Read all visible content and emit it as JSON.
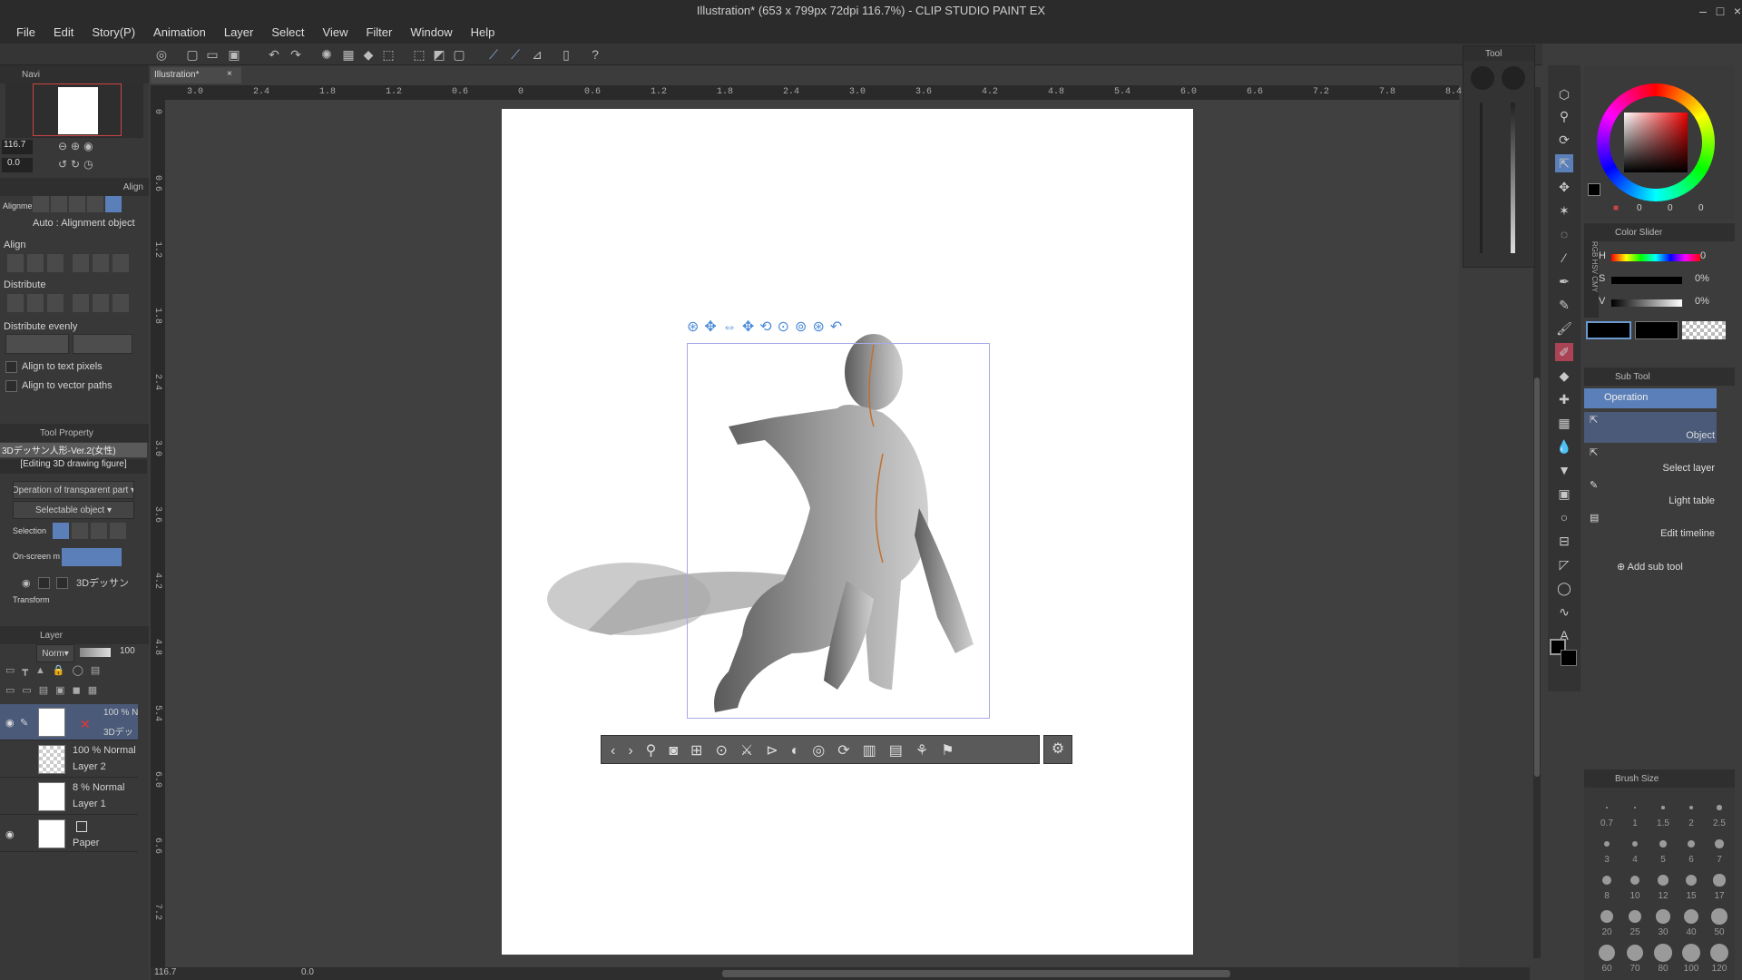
{
  "window": {
    "title": "Illustration* (653 x 799px 72dpi 116.7%)  - CLIP STUDIO PAINT EX"
  },
  "menu": [
    "File",
    "Edit",
    "Story(P)",
    "Animation",
    "Layer",
    "Select",
    "View",
    "Filter",
    "Window",
    "Help"
  ],
  "canvas_tab": {
    "label": "Illustration*",
    "close": "×"
  },
  "ruler_h_labels": [
    "3.0",
    "2.4",
    "1.8",
    "1.2",
    "0.6",
    "0",
    "0.6",
    "1.2",
    "1.8",
    "2.4",
    "3.0",
    "3.6",
    "4.2",
    "4.8",
    "5.4",
    "6.0",
    "6.6",
    "7.2",
    "7.8",
    "8.4"
  ],
  "ruler_v_labels": [
    "0",
    "0.6",
    "1.2",
    "1.8",
    "2.4",
    "3.0",
    "3.6",
    "4.2",
    "4.8",
    "5.4",
    "6.0",
    "6.6",
    "7.2"
  ],
  "navigator": {
    "title": "Navi",
    "zoom": "116.7",
    "angle": "0.0"
  },
  "align_panel": {
    "tab": "Align",
    "alignment_label": "Alignme",
    "auto_text": "Auto : Alignment object",
    "align_heading": "Align",
    "distribute_heading": "Distribute",
    "distribute_evenly_heading": "Distribute evenly",
    "align_text_pixels": "Align to text pixels",
    "align_vector_paths": "Align to vector paths"
  },
  "tool_property": {
    "title": "Tool Property",
    "name": "3Dデッサン人形-Ver.2(女性)",
    "editing": "[Editing 3D drawing figure]",
    "operation_transparent": "Operation of transparent part",
    "selectable_object": "Selectable object",
    "selection_label": "Selection",
    "onscreen_label": "On-screen m",
    "object_name": "3Dデッサン",
    "transform_label": "Transform"
  },
  "layer_panel": {
    "title": "Layer",
    "blend": "Norm",
    "opacity": "100",
    "layers": [
      {
        "line1": "100 % N",
        "line2": "3Dデッ",
        "selected": true
      },
      {
        "line1": "100 % Normal",
        "line2": "Layer 2",
        "selected": false
      },
      {
        "line1": "8 % Normal",
        "line2": "Layer 1",
        "selected": false
      },
      {
        "line1": "",
        "line2": "Paper",
        "selected": false
      }
    ]
  },
  "status_bar": {
    "zoom": "116.7",
    "angle": "0.0"
  },
  "color_wheel": {
    "values": [
      "0",
      "0",
      "0"
    ]
  },
  "color_slider": {
    "title": "Color Slider",
    "rows": [
      {
        "label": "H",
        "value": "0"
      },
      {
        "label": "S",
        "value": "0%"
      },
      {
        "label": "V",
        "value": "0%"
      }
    ],
    "hsv_tab": "HSV",
    "rgb_tab": "RGB",
    "cmy_tab": "CMY"
  },
  "tool_panel": {
    "title": "Tool"
  },
  "sub_tool": {
    "title": "Sub Tool",
    "group": "Operation",
    "items": [
      "Object",
      "Select layer",
      "Light table",
      "Edit timeline"
    ],
    "add": "Add sub tool"
  },
  "brush_size": {
    "title": "Brush Size",
    "sizes": [
      "0.7",
      "1",
      "1.5",
      "2",
      "2.5",
      "3",
      "4",
      "5",
      "6",
      "7",
      "8",
      "10",
      "12",
      "15",
      "17",
      "20",
      "25",
      "30",
      "40",
      "50",
      "60",
      "70",
      "80",
      "100",
      "120"
    ]
  },
  "accent_color": "#5b7fb8",
  "selection_color": "#8fb4e3"
}
